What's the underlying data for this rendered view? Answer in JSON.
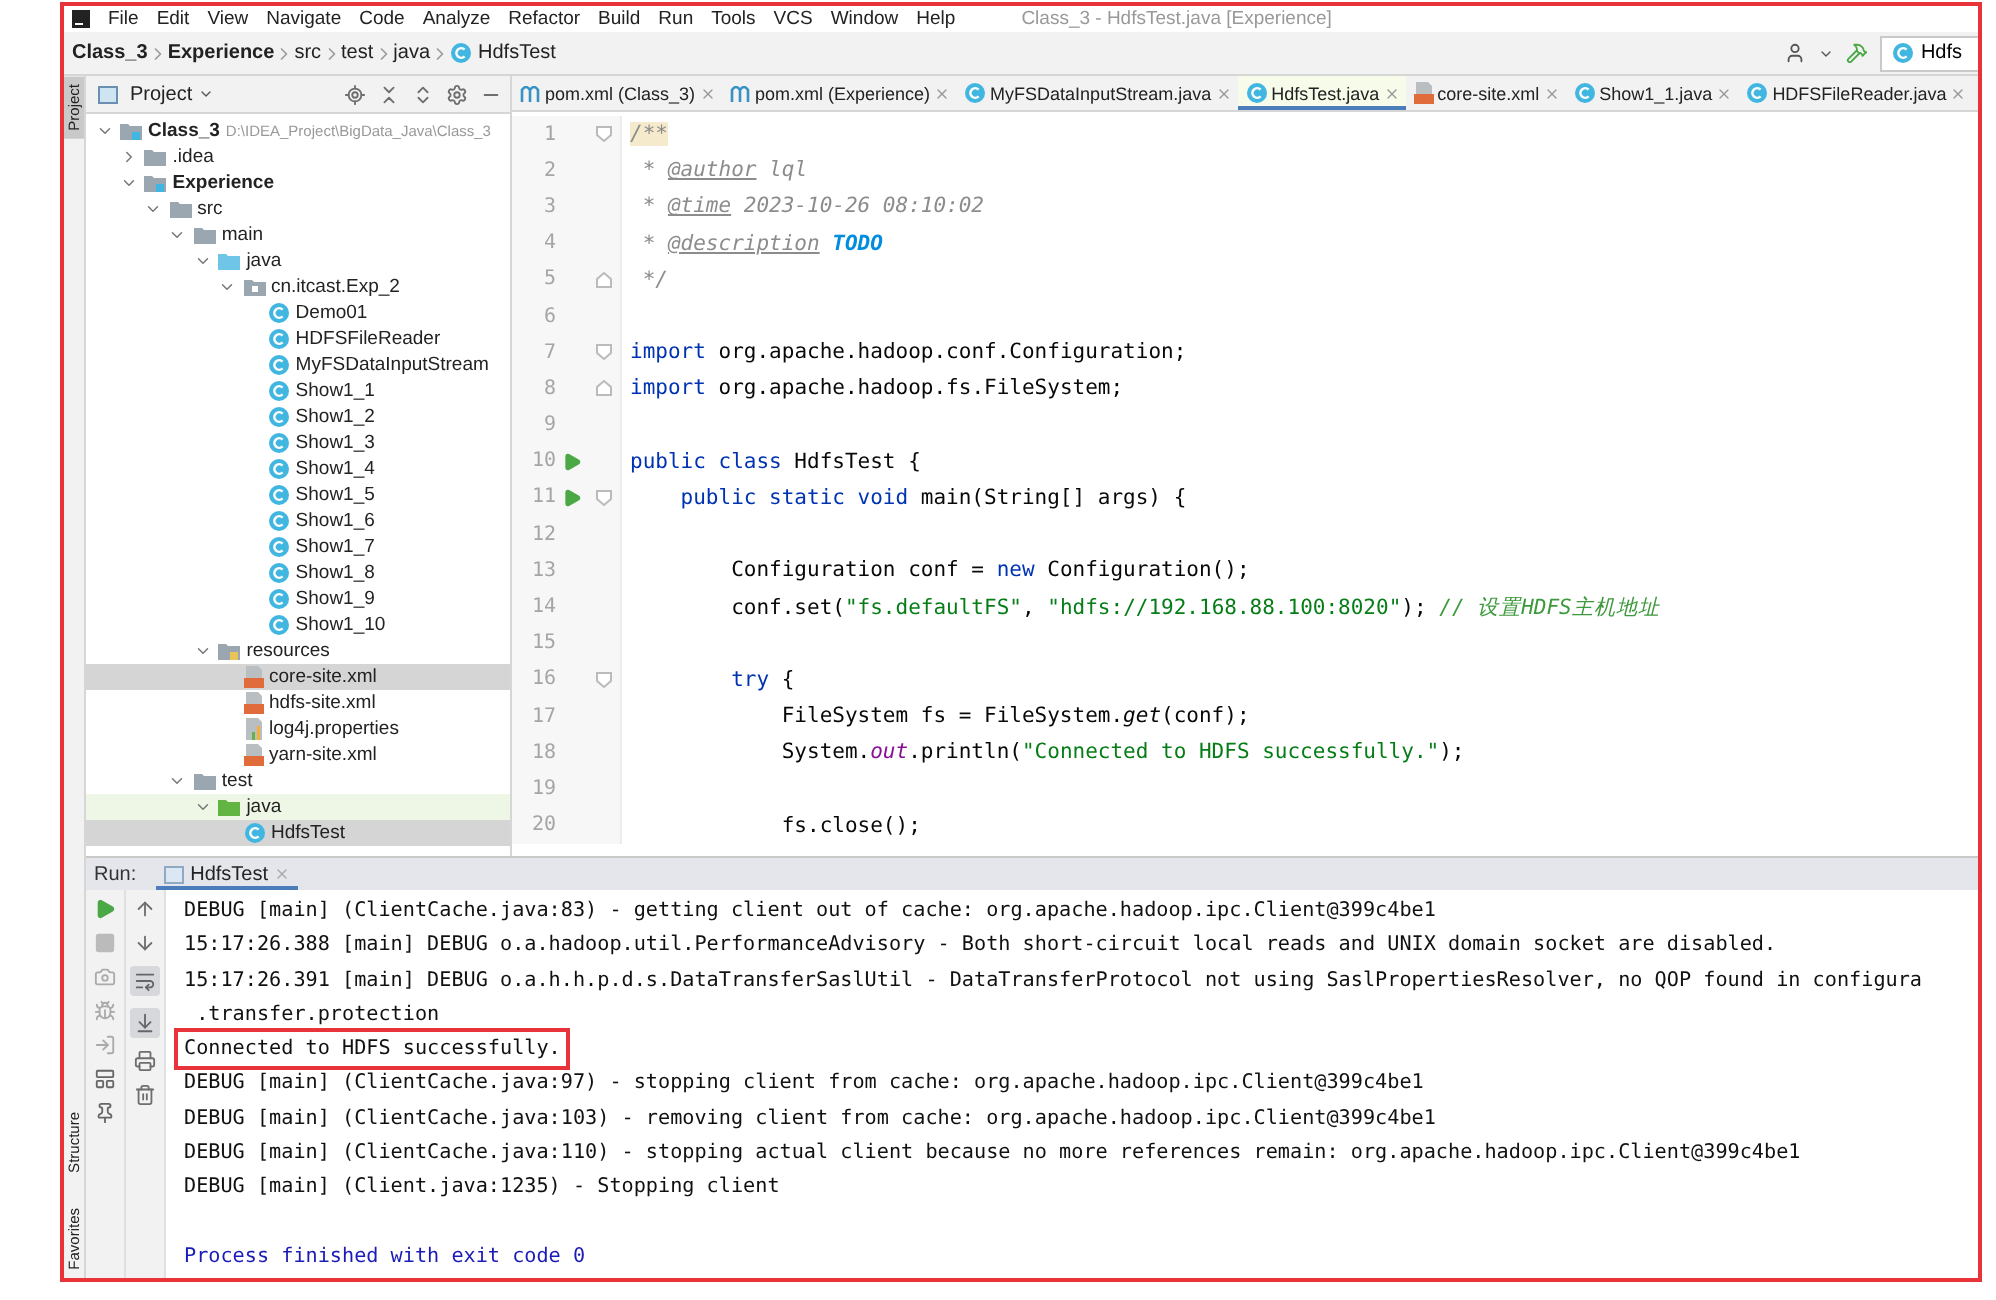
{
  "window": {
    "title": "Class_3 - HdfsTest.java [Experience]"
  },
  "menu": [
    "File",
    "Edit",
    "View",
    "Navigate",
    "Code",
    "Analyze",
    "Refactor",
    "Build",
    "Run",
    "Tools",
    "VCS",
    "Window",
    "Help"
  ],
  "breadcrumb": [
    {
      "label": "Class_3",
      "kind": "module"
    },
    {
      "label": "Experience",
      "kind": "module"
    },
    {
      "label": "src",
      "kind": "folder"
    },
    {
      "label": "test",
      "kind": "folder"
    },
    {
      "label": "java",
      "kind": "folder"
    },
    {
      "label": "HdfsTest",
      "kind": "class"
    }
  ],
  "toolbar": {
    "run_config": "Hdfs"
  },
  "left_strip": {
    "top": [
      {
        "label": "Project",
        "selected": true
      }
    ],
    "bottom": [
      {
        "label": "Structure",
        "selected": false
      },
      {
        "label": "Favorites",
        "selected": false
      }
    ]
  },
  "project": {
    "title": "Project",
    "tree": [
      {
        "label": "Class_3",
        "kind": "module",
        "path": "D:\\IDEA_Project\\BigData_Java\\Class_3",
        "expanded": true,
        "selected": false,
        "children": [
          {
            "label": ".idea",
            "kind": "folder",
            "expanded": false,
            "selected": false
          },
          {
            "label": "Experience",
            "kind": "module",
            "expanded": true,
            "selected": false,
            "children": [
              {
                "label": "src",
                "kind": "folder",
                "expanded": true,
                "selected": false,
                "children": [
                  {
                    "label": "main",
                    "kind": "folder",
                    "expanded": true,
                    "selected": false,
                    "children": [
                      {
                        "label": "java",
                        "kind": "source-folder",
                        "expanded": true,
                        "selected": false,
                        "children": [
                          {
                            "label": "cn.itcast.Exp_2",
                            "kind": "package",
                            "expanded": true,
                            "selected": false,
                            "children": [
                              {
                                "label": "Demo01",
                                "kind": "class",
                                "selected": false
                              },
                              {
                                "label": "HDFSFileReader",
                                "kind": "class",
                                "selected": false
                              },
                              {
                                "label": "MyFSDataInputStream",
                                "kind": "class",
                                "selected": false
                              },
                              {
                                "label": "Show1_1",
                                "kind": "class",
                                "selected": false
                              },
                              {
                                "label": "Show1_2",
                                "kind": "class",
                                "selected": false
                              },
                              {
                                "label": "Show1_3",
                                "kind": "class",
                                "selected": false
                              },
                              {
                                "label": "Show1_4",
                                "kind": "class",
                                "selected": false
                              },
                              {
                                "label": "Show1_5",
                                "kind": "class",
                                "selected": false
                              },
                              {
                                "label": "Show1_6",
                                "kind": "class",
                                "selected": false
                              },
                              {
                                "label": "Show1_7",
                                "kind": "class",
                                "selected": false
                              },
                              {
                                "label": "Show1_8",
                                "kind": "class",
                                "selected": false
                              },
                              {
                                "label": "Show1_9",
                                "kind": "class",
                                "selected": false
                              },
                              {
                                "label": "Show1_10",
                                "kind": "class",
                                "selected": false
                              }
                            ]
                          }
                        ]
                      },
                      {
                        "label": "resources",
                        "kind": "resources-folder",
                        "expanded": true,
                        "selected": false,
                        "children": [
                          {
                            "label": "core-site.xml",
                            "kind": "xml",
                            "selected": true
                          },
                          {
                            "label": "hdfs-site.xml",
                            "kind": "xml",
                            "selected": false
                          },
                          {
                            "label": "log4j.properties",
                            "kind": "properties",
                            "selected": false
                          },
                          {
                            "label": "yarn-site.xml",
                            "kind": "xml",
                            "selected": false
                          }
                        ]
                      }
                    ]
                  },
                  {
                    "label": "test",
                    "kind": "folder",
                    "expanded": true,
                    "selected": false,
                    "children": [
                      {
                        "label": "java",
                        "kind": "test-folder",
                        "expanded": true,
                        "selected": false,
                        "children": [
                          {
                            "label": "HdfsTest",
                            "kind": "class",
                            "selected": true
                          }
                        ]
                      }
                    ]
                  }
                ]
              }
            ]
          }
        ]
      }
    ]
  },
  "editor": {
    "tabs": [
      {
        "label": "pom.xml (Class_3)",
        "kind": "maven",
        "selected": false
      },
      {
        "label": "pom.xml (Experience)",
        "kind": "maven",
        "selected": false
      },
      {
        "label": "MyFSDataInputStream.java",
        "kind": "class",
        "selected": false
      },
      {
        "label": "HdfsTest.java",
        "kind": "class",
        "selected": true
      },
      {
        "label": "core-site.xml",
        "kind": "xml",
        "selected": false
      },
      {
        "label": "Show1_1.java",
        "kind": "class",
        "selected": false
      },
      {
        "label": "HDFSFileReader.java",
        "kind": "class",
        "selected": false
      }
    ],
    "lines": [
      {
        "number": "1",
        "fold_start": true,
        "segments": [
          {
            "text": "/**",
            "kind": "comment-match"
          }
        ]
      },
      {
        "number": "2",
        "segments": [
          {
            "text": " * ",
            "kind": "comment"
          },
          {
            "text": "@author",
            "kind": "doctag"
          },
          {
            "text": " lql",
            "kind": "comment"
          }
        ]
      },
      {
        "number": "3",
        "segments": [
          {
            "text": " * ",
            "kind": "comment"
          },
          {
            "text": "@time",
            "kind": "doctag"
          },
          {
            "text": " 2023-10-26 08:10:02",
            "kind": "comment"
          }
        ]
      },
      {
        "number": "4",
        "segments": [
          {
            "text": " * ",
            "kind": "comment"
          },
          {
            "text": "@description",
            "kind": "doctag"
          },
          {
            "text": " TODO",
            "kind": "todo"
          }
        ]
      },
      {
        "number": "5",
        "fold_end": true,
        "segments": [
          {
            "text": " */",
            "kind": "comment"
          }
        ]
      },
      {
        "number": "6"
      },
      {
        "number": "7",
        "fold_start": true,
        "segments": [
          {
            "text": "import",
            "kind": "keyword"
          },
          {
            "text": " org.apache.hadoop.conf.Configuration;",
            "kind": "plain"
          }
        ]
      },
      {
        "number": "8",
        "fold_end": true,
        "segments": [
          {
            "text": "import",
            "kind": "keyword"
          },
          {
            "text": " org.apache.hadoop.fs.FileSystem;",
            "kind": "plain"
          }
        ]
      },
      {
        "number": "9"
      },
      {
        "number": "10",
        "runnable": true,
        "segments": [
          {
            "text": "public class",
            "kind": "keyword"
          },
          {
            "text": " HdfsTest {",
            "kind": "plain"
          }
        ]
      },
      {
        "number": "11",
        "runnable": true,
        "fold_start": true,
        "segments": [
          {
            "text": "    public static void",
            "kind": "keyword"
          },
          {
            "text": " main(String[] args) {",
            "kind": "plain"
          }
        ]
      },
      {
        "number": "12"
      },
      {
        "number": "13",
        "segments": [
          {
            "text": "        Configuration conf = ",
            "kind": "plain"
          },
          {
            "text": "new",
            "kind": "keyword"
          },
          {
            "text": " Configuration();",
            "kind": "plain"
          }
        ]
      },
      {
        "number": "14",
        "segments": [
          {
            "text": "        conf.set(",
            "kind": "plain"
          },
          {
            "text": "\"fs.defaultFS\"",
            "kind": "string"
          },
          {
            "text": ", ",
            "kind": "plain"
          },
          {
            "text": "\"hdfs://192.168.88.100:8020\"",
            "kind": "string"
          },
          {
            "text": "); ",
            "kind": "plain"
          },
          {
            "text": "// 设置HDFS主机地址",
            "kind": "line-comment"
          }
        ]
      },
      {
        "number": "15"
      },
      {
        "number": "16",
        "fold_start": true,
        "segments": [
          {
            "text": "        try",
            "kind": "keyword"
          },
          {
            "text": " {",
            "kind": "plain"
          }
        ]
      },
      {
        "number": "17",
        "segments": [
          {
            "text": "            FileSystem fs = FileSystem.",
            "kind": "plain"
          },
          {
            "text": "get",
            "kind": "static"
          },
          {
            "text": "(conf);",
            "kind": "plain"
          }
        ]
      },
      {
        "number": "18",
        "segments": [
          {
            "text": "            System.",
            "kind": "plain"
          },
          {
            "text": "out",
            "kind": "field"
          },
          {
            "text": ".println(",
            "kind": "plain"
          },
          {
            "text": "\"Connected to HDFS successfully.\"",
            "kind": "string"
          },
          {
            "text": ");",
            "kind": "plain"
          }
        ]
      },
      {
        "number": "19"
      },
      {
        "number": "20",
        "segments": [
          {
            "text": "            fs.close();",
            "kind": "plain"
          }
        ]
      }
    ]
  },
  "run_panel": {
    "label": "Run:",
    "tabs": [
      {
        "label": "HdfsTest",
        "selected": true
      }
    ],
    "toggles": {
      "soft_wrap": true,
      "scroll_to_end": true
    },
    "console": [
      {
        "text": "DEBUG [main] (ClientCache.java:83) - getting client out of cache: org.apache.hadoop.ipc.Client@399c4be1",
        "kind": "log"
      },
      {
        "text": "15:17:26.388 [main] DEBUG o.a.hadoop.util.PerformanceAdvisory - Both short-circuit local reads and UNIX domain socket are disabled.",
        "kind": "log"
      },
      {
        "text": "15:17:26.391 [main] DEBUG o.a.h.h.p.d.s.DataTransferSaslUtil - DataTransferProtocol not using SaslPropertiesResolver, no QOP found in configura",
        "kind": "log"
      },
      {
        "text": " .transfer.protection",
        "kind": "log"
      },
      {
        "text": "Connected to HDFS successfully.",
        "kind": "boxed"
      },
      {
        "text": "DEBUG [main] (ClientCache.java:97) - stopping client from cache: org.apache.hadoop.ipc.Client@399c4be1",
        "kind": "log"
      },
      {
        "text": "DEBUG [main] (ClientCache.java:103) - removing client from cache: org.apache.hadoop.ipc.Client@399c4be1",
        "kind": "log"
      },
      {
        "text": "DEBUG [main] (ClientCache.java:110) - stopping actual client because no more references remain: org.apache.hadoop.ipc.Client@399c4be1",
        "kind": "log"
      },
      {
        "text": "DEBUG [main] (Client.java:1235) - Stopping client",
        "kind": "log"
      },
      {
        "text": "Process finished with exit code 0",
        "kind": "exit"
      }
    ]
  }
}
